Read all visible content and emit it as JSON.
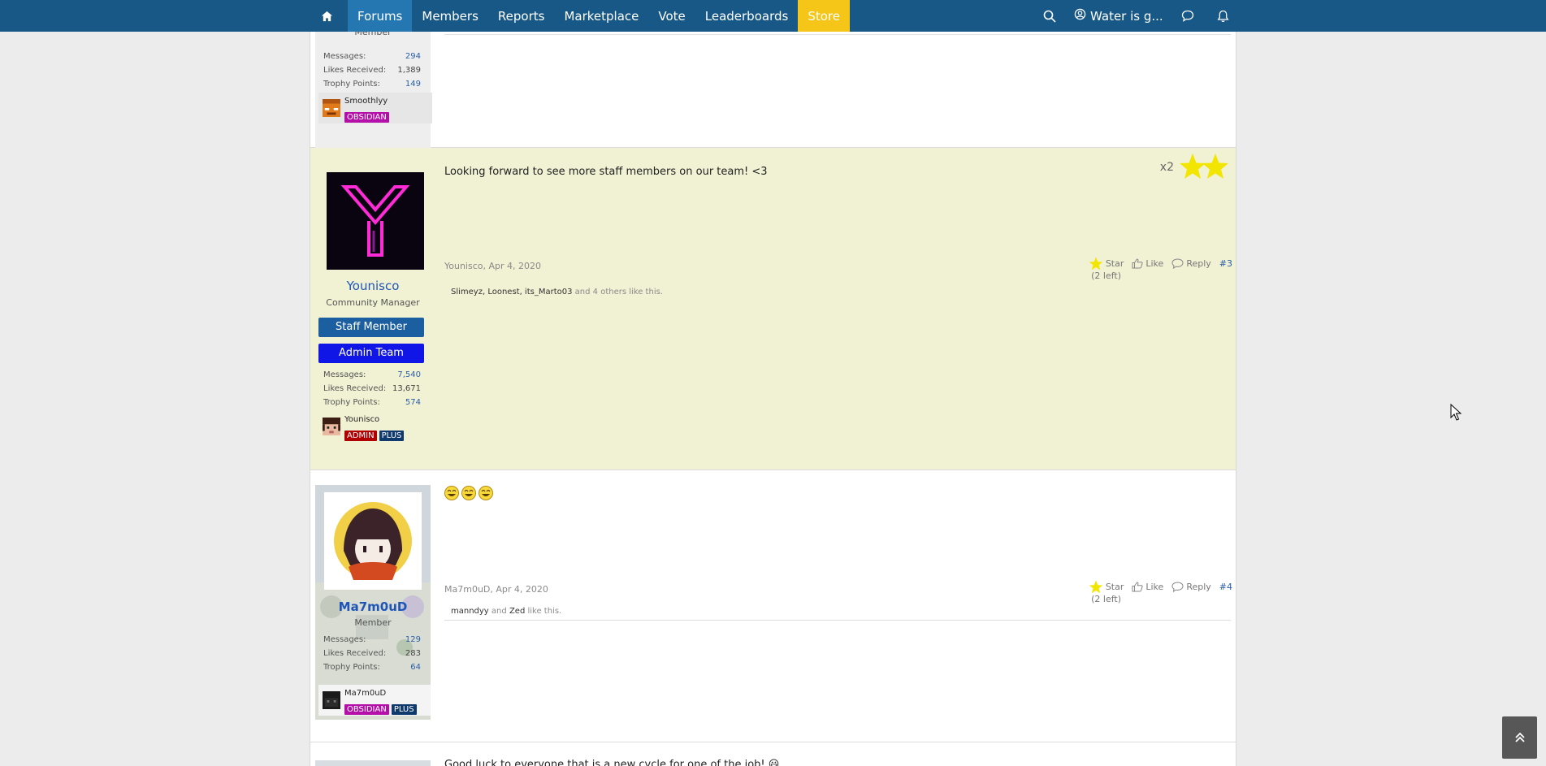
{
  "nav": {
    "tabs": [
      "Forums",
      "Members",
      "Reports",
      "Marketplace",
      "Vote",
      "Leaderboards",
      "Store"
    ],
    "active_tab": "Forums",
    "user_label": "Water is g...",
    "icons": [
      "home-icon",
      "search-icon",
      "user-shield-icon",
      "chat-bubble-icon",
      "bell-icon"
    ],
    "store_color": "#f5c518",
    "bar_color": "#185886"
  },
  "post_top": {
    "usertitle": "Member",
    "stats": [
      {
        "label": "Messages:",
        "value": "294"
      },
      {
        "label": "Likes Received:",
        "value": "1,389"
      },
      {
        "label": "Trophy Points:",
        "value": "149"
      }
    ],
    "mc_name": "Smoothlyy",
    "tags": [
      "OBSIDIAN"
    ]
  },
  "post3": {
    "message": "Looking forward to see more staff members on our team! <3",
    "star_count": "x2",
    "username": "Younisco",
    "usertitle": "Community Manager",
    "banners": [
      "Staff Member",
      "Admin Team"
    ],
    "stats": [
      {
        "label": "Messages:",
        "value": "7,540"
      },
      {
        "label": "Likes Received:",
        "value": "13,671"
      },
      {
        "label": "Trophy Points:",
        "value": "574"
      }
    ],
    "mc_name": "Younisco",
    "tags": [
      "ADMIN",
      "PLUS"
    ],
    "meta_author": "Younisco",
    "meta_date": "Apr 4, 2020",
    "actions": {
      "star": "Star",
      "star_left": "(2 left)",
      "like": "Like",
      "reply": "Reply",
      "number": "#3"
    },
    "likes": {
      "names": "Slimeyz, Loonest, its_Marto03",
      "rest": "and 4 others like this."
    }
  },
  "post4": {
    "message": "😃😃😃",
    "username": "Ma7m0uD",
    "usertitle": "Member",
    "stats": [
      {
        "label": "Messages:",
        "value": "129"
      },
      {
        "label": "Likes Received:",
        "value": "283"
      },
      {
        "label": "Trophy Points:",
        "value": "64"
      }
    ],
    "mc_name": "Ma7m0uD",
    "tags": [
      "OBSIDIAN",
      "PLUS"
    ],
    "meta_author": "Ma7m0uD",
    "meta_date": "Apr 4, 2020",
    "actions": {
      "star": "Star",
      "star_left": "(2 left)",
      "like": "Like",
      "reply": "Reply",
      "number": "#4"
    },
    "likes": {
      "name1": "manndyy",
      "and": "and",
      "name2": "Zed",
      "rest": "like this."
    }
  },
  "post5_preview": "Good luck to everyone that is a new cycle for one of the job! 😃"
}
